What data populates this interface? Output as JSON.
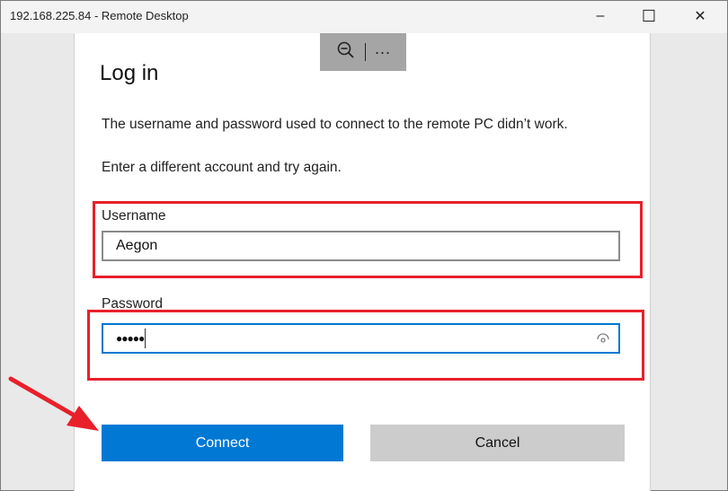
{
  "window": {
    "title": "192.168.225.84 - Remote Desktop",
    "minimize": "–",
    "maximize": "☐",
    "close": "✕"
  },
  "toolbar": {
    "zoom_icon": "zoom-out-icon",
    "more": "···"
  },
  "dialog": {
    "title": "Log in",
    "message": "The username and password used to connect to the remote PC didn’t work.",
    "instruction": "Enter a different account and try again.",
    "username_label": "Username",
    "username_value": "Aegon",
    "password_label": "Password",
    "password_value": "●●●●●",
    "connect": "Connect",
    "cancel": "Cancel"
  },
  "colors": {
    "accent": "#0078d4",
    "annotation": "#e8202a"
  }
}
